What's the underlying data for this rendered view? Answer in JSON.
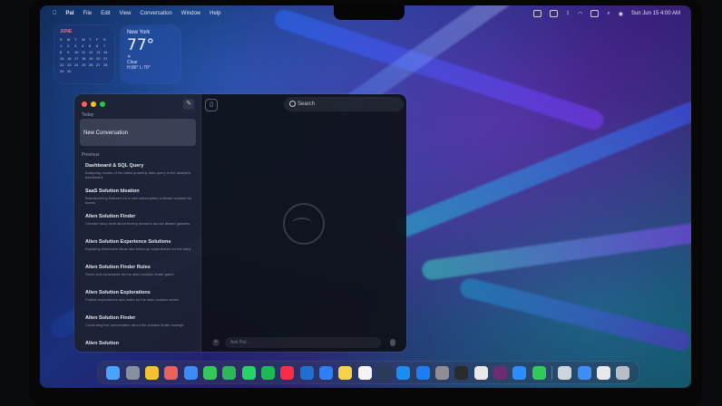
{
  "menubar": {
    "apple": "",
    "app_name": "Pal",
    "items": [
      "File",
      "Edit",
      "View",
      "Conversation",
      "Window",
      "Help"
    ],
    "clock": "Sun Jun 15  4:00 AM"
  },
  "widgets": {
    "calendar": {
      "month": "JUNE",
      "weekdays": [
        "S",
        "M",
        "T",
        "W",
        "T",
        "F",
        "S"
      ],
      "days": [
        "1",
        "2",
        "3",
        "4",
        "5",
        "6",
        "7",
        "8",
        "9",
        "10",
        "11",
        "12",
        "13",
        "14",
        "15",
        "16",
        "17",
        "18",
        "19",
        "20",
        "21",
        "22",
        "23",
        "24",
        "25",
        "26",
        "27",
        "28",
        "29",
        "30"
      ]
    },
    "weather": {
      "city": "New York",
      "temp": "77°",
      "condition": "Clear",
      "range": "H:86° L:70°"
    }
  },
  "sidebar": {
    "today_label": "Today",
    "selected_item": "New Conversation",
    "previous_label": "Previous",
    "conversations": [
      {
        "title": "Dashboard & SQL Query",
        "preview": "Analyzing results of the latest quarterly data query in the analytics dashboard"
      },
      {
        "title": "SaaS Solution Ideation",
        "preview": "Brainstorming features for a new subscription software solution for teams"
      },
      {
        "title": "Alien Solution Finder",
        "preview": "Creative story draft about finding answers across distant galaxies"
      },
      {
        "title": "Alien Solution Experience Solutions",
        "preview": "Exploring immersive ideas and follow-up experiences for the story"
      },
      {
        "title": "Alien Solution Finder Rules",
        "preview": "Rules and constraints for the alien solution finder game"
      },
      {
        "title": "Alien Solution Explorations",
        "preview": "Further explorations and drafts for the alien solution series"
      },
      {
        "title": "Alien Solution Finder",
        "preview": "Continuing the conversation about the solution finder concept"
      },
      {
        "title": "Alien Solution",
        "preview": ""
      }
    ]
  },
  "main": {
    "search_placeholder": "Search",
    "composer_placeholder": "Ask Pal..."
  },
  "dock": {
    "apps": [
      {
        "name": "finder",
        "color": "#4aa3ff"
      },
      {
        "name": "launchpad",
        "color": "#8a8fa0"
      },
      {
        "name": "chrome",
        "color": "#f1c232"
      },
      {
        "name": "photos",
        "color": "#e8615a"
      },
      {
        "name": "safari",
        "color": "#3d8bf7"
      },
      {
        "name": "messages",
        "color": "#34c759"
      },
      {
        "name": "facetime",
        "color": "#2fb55a"
      },
      {
        "name": "whatsapp",
        "color": "#25d366"
      },
      {
        "name": "spotify",
        "color": "#1db954"
      },
      {
        "name": "music",
        "color": "#fa2d48"
      },
      {
        "name": "vscode",
        "color": "#1f6fd1"
      },
      {
        "name": "mail",
        "color": "#2f7ef5"
      },
      {
        "name": "notes",
        "color": "#f7d34a"
      },
      {
        "name": "calendar",
        "color": "#f4f4f6"
      },
      {
        "name": "steam",
        "color": "#2a3b56"
      },
      {
        "name": "xcode",
        "color": "#1b8cf0"
      },
      {
        "name": "appstore",
        "color": "#1c7ef2"
      },
      {
        "name": "system-settings",
        "color": "#8e8e93"
      },
      {
        "name": "terminal",
        "color": "#2b2b2b"
      },
      {
        "name": "notion",
        "color": "#e9e9e9"
      },
      {
        "name": "slack",
        "color": "#6b2c70"
      },
      {
        "name": "zoom",
        "color": "#2d8cff"
      },
      {
        "name": "phone",
        "color": "#30c95a"
      }
    ],
    "right_items": [
      {
        "name": "preview",
        "color": "#cfd4dd"
      },
      {
        "name": "downloads-folder",
        "color": "#3f8ef5"
      },
      {
        "name": "documents-folder",
        "color": "#e7e9ee"
      },
      {
        "name": "trash",
        "color": "#b8bcc6"
      }
    ]
  }
}
